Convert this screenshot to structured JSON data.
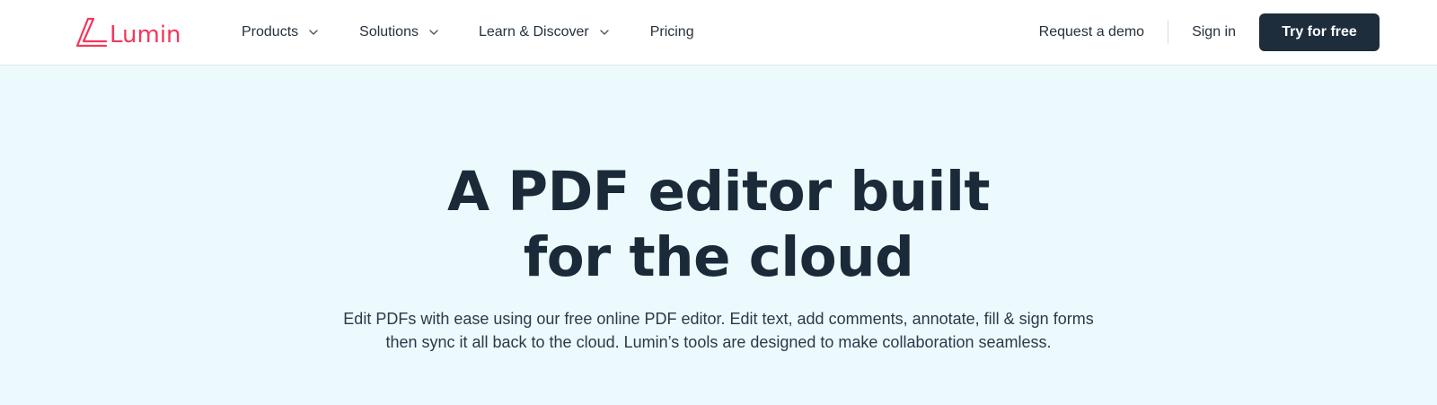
{
  "brand": {
    "name": "Lumin",
    "color": "#f2385a"
  },
  "nav": {
    "items": [
      {
        "label": "Products",
        "has_dropdown": true
      },
      {
        "label": "Solutions",
        "has_dropdown": true
      },
      {
        "label": "Learn & Discover",
        "has_dropdown": true
      },
      {
        "label": "Pricing",
        "has_dropdown": false
      }
    ]
  },
  "actions": {
    "demo_label": "Request a demo",
    "signin_label": "Sign in",
    "try_label": "Try for free",
    "try_color": "#1e2d3b"
  },
  "hero": {
    "title_line1": "A PDF editor built",
    "title_line2": "for the cloud",
    "subtitle": "Edit PDFs with ease using our free online PDF editor. Edit text, add comments, annotate,  fill & sign forms then sync it all back to the cloud. Lumin’s tools are designed to make collaboration seamless.",
    "background": "#ecf9fd"
  },
  "icons": {
    "logo": "lumin-logo-icon",
    "dropdown": "chevron-down-icon"
  }
}
